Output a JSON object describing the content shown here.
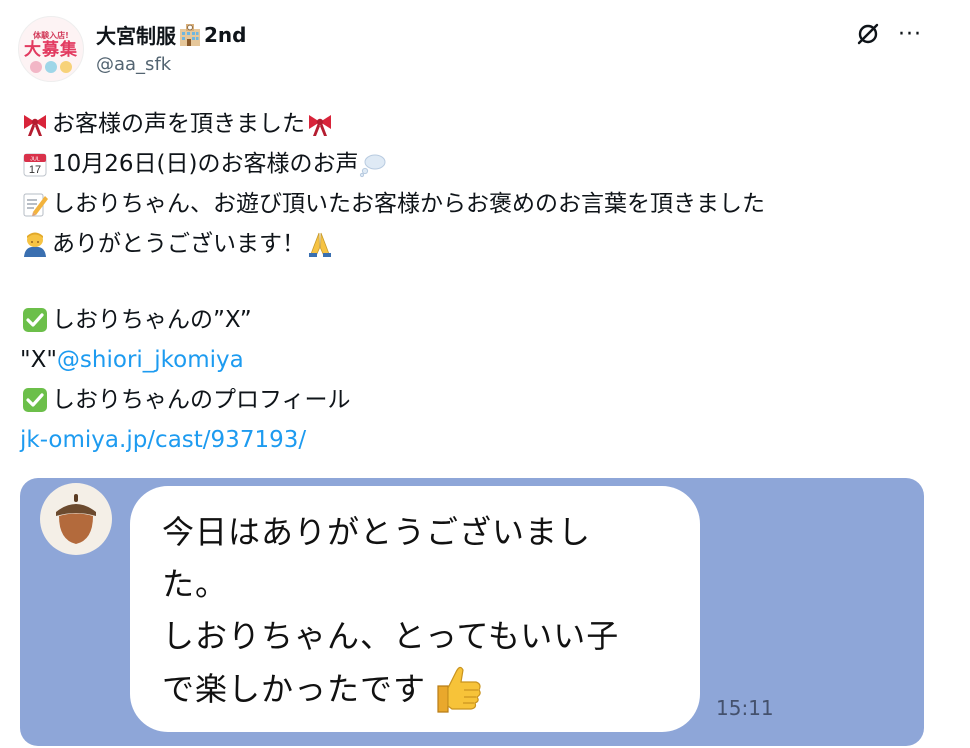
{
  "author": {
    "display_name": "大宮制服",
    "display_suffix": "2nd",
    "handle": "@aa_sfk",
    "avatar_text_top": "体験入店!",
    "avatar_text_big": "大募集"
  },
  "header": {
    "grok_icon": "grok-slash-icon",
    "more_label": "···"
  },
  "tweet": {
    "line1": "お客様の声を頂きました",
    "line2": "10月26日(日)のお客様のお声",
    "line3": "しおりちゃん、お遊び頂いたお客様からお褒めのお言葉を頂きました",
    "line4": "ありがとうございます！",
    "line5": "しおりちゃんの”X”",
    "line6_prefix": "\"X\"",
    "line6_mention": "@shiori_jkomiya",
    "line7": "しおりちゃんのプロフィール",
    "line8_link": "jk-omiya.jp/cast/937193/"
  },
  "media": {
    "chat_line1": "今日はありがとうございまし",
    "chat_line2": "た。",
    "chat_line3": "しおりちゃん、とってもいい子",
    "chat_line4": "で楽しかったです",
    "chat_time": "15:11"
  },
  "colors": {
    "link": "#1d9bf0",
    "chat_background": "#8ea6d8",
    "text": "#0f1419",
    "secondary": "#536471"
  }
}
